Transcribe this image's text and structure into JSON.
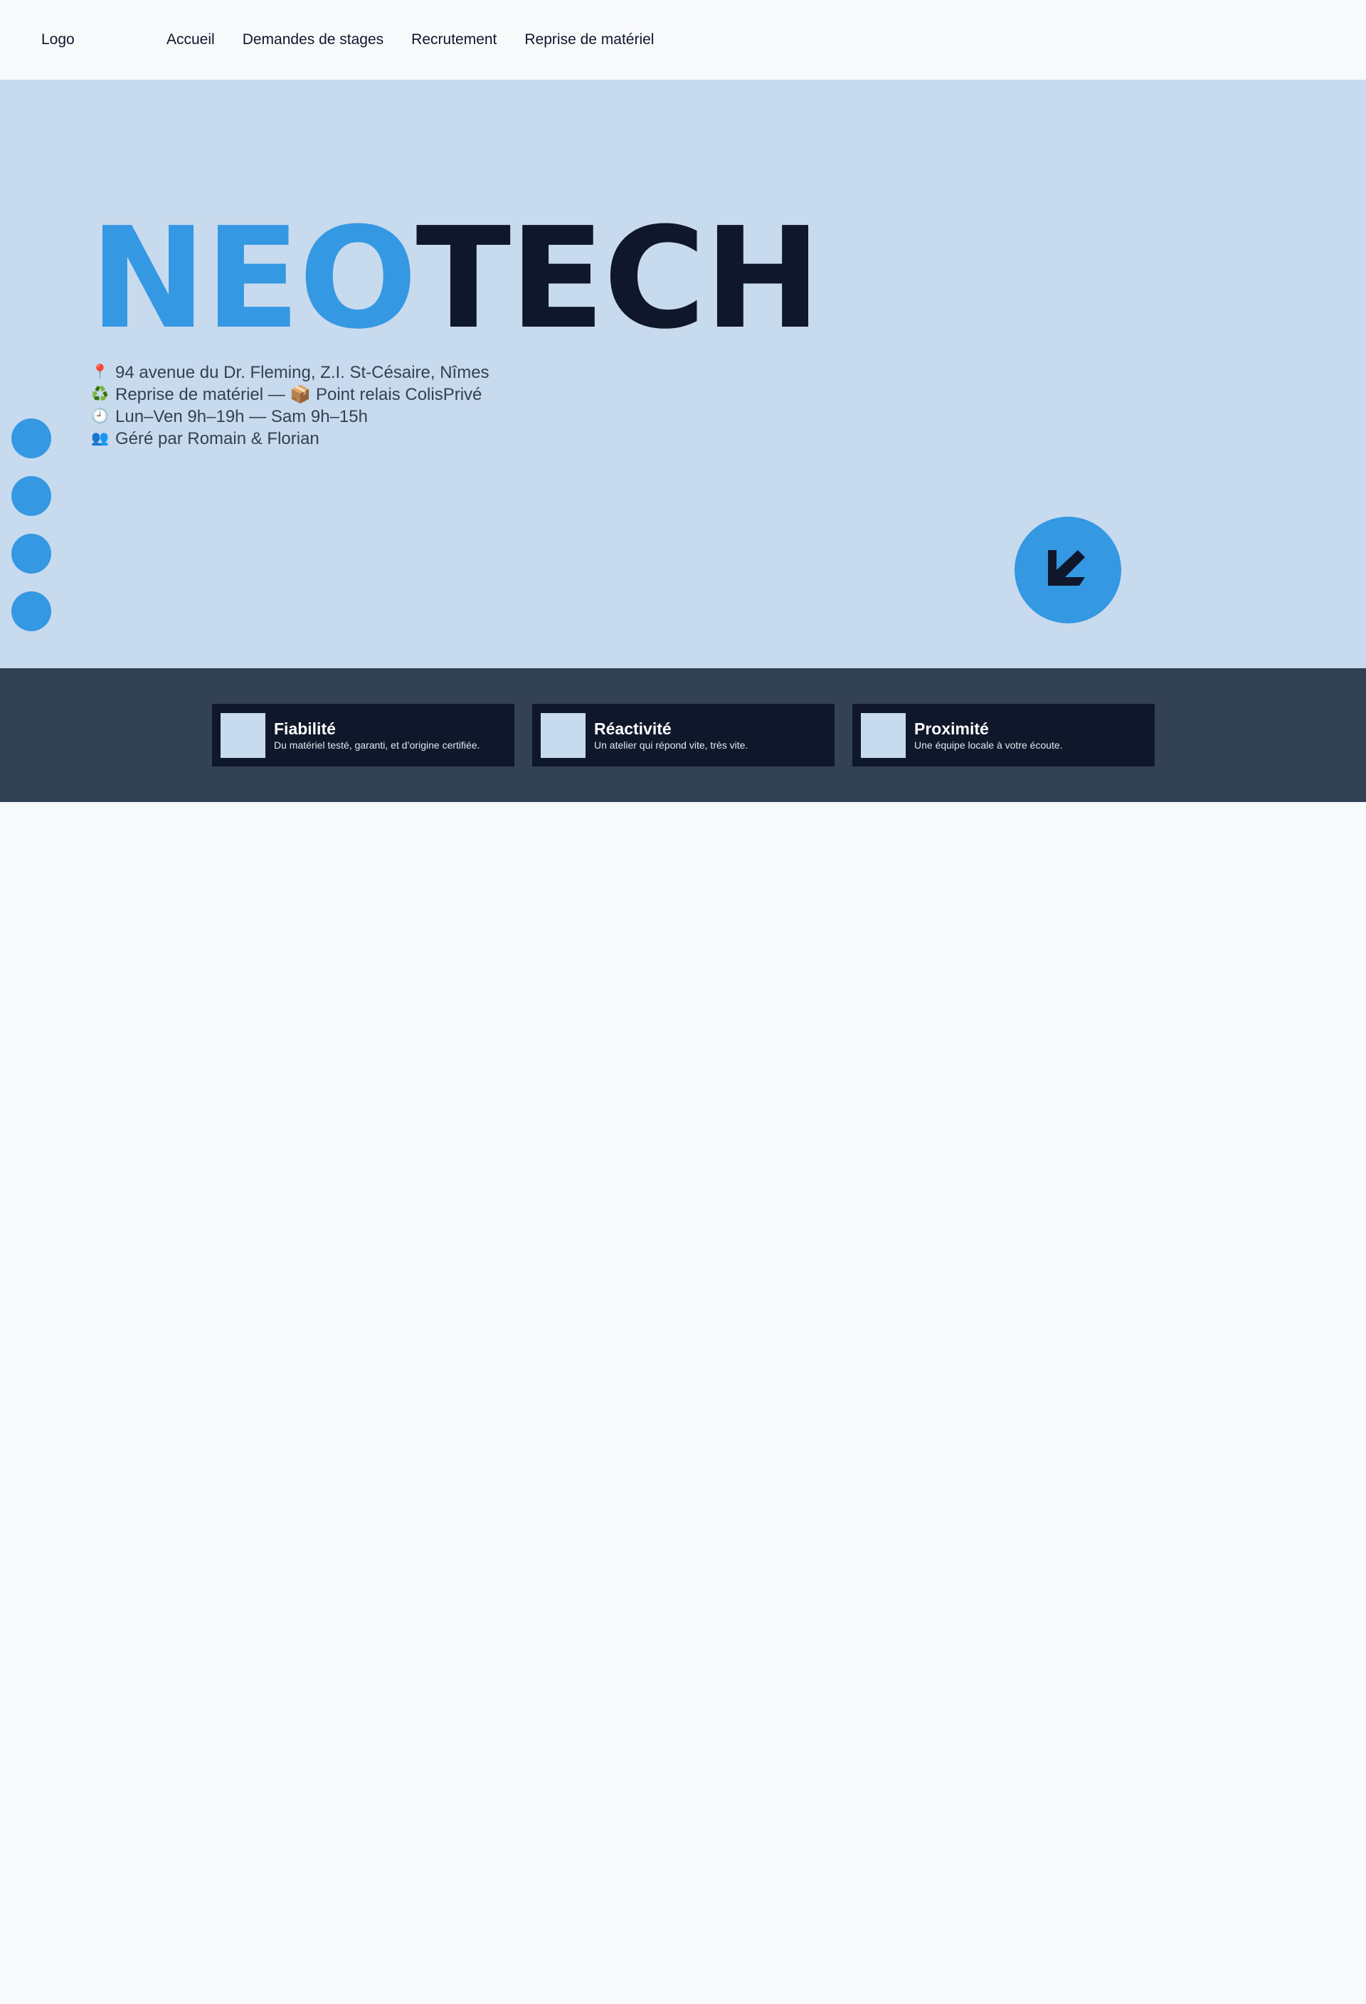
{
  "header": {
    "logo": "Logo",
    "nav": [
      "Accueil",
      "Demandes de stages",
      "Recrutement",
      "Reprise de matériel"
    ]
  },
  "hero": {
    "title_part1": "NEO",
    "title_part2": "TECH",
    "info": [
      {
        "icon": "📍",
        "icon_name": "pin-icon",
        "text": "94 avenue du Dr. Fleming, Z.I. St-Césaire, Nîmes"
      },
      {
        "icon": "♻️",
        "icon_name": "recycle-icon",
        "text": "Reprise de matériel — 📦 Point relais ColisPrivé"
      },
      {
        "icon": "🕘",
        "icon_name": "clock-icon",
        "text": "Lun–Ven 9h–19h — Sam 9h–15h"
      },
      {
        "icon": "👥",
        "icon_name": "people-icon",
        "text": "Géré par Romain & Florian"
      }
    ],
    "scroll_button_icon": "arrow-down-left-icon"
  },
  "features": [
    {
      "title": "Fiabilité",
      "desc": "Du matériel testé, garanti, et d’origine certifiée."
    },
    {
      "title": "Réactivité",
      "desc": "Un atelier qui répond vite, très vite."
    },
    {
      "title": "Proximité",
      "desc": "Une équipe locale à votre écoute."
    }
  ],
  "colors": {
    "accent": "#3498e2",
    "dark": "#0f172a",
    "hero_bg": "#c8daee",
    "band_bg": "#334155",
    "page_bg": "#f7f9fb"
  }
}
